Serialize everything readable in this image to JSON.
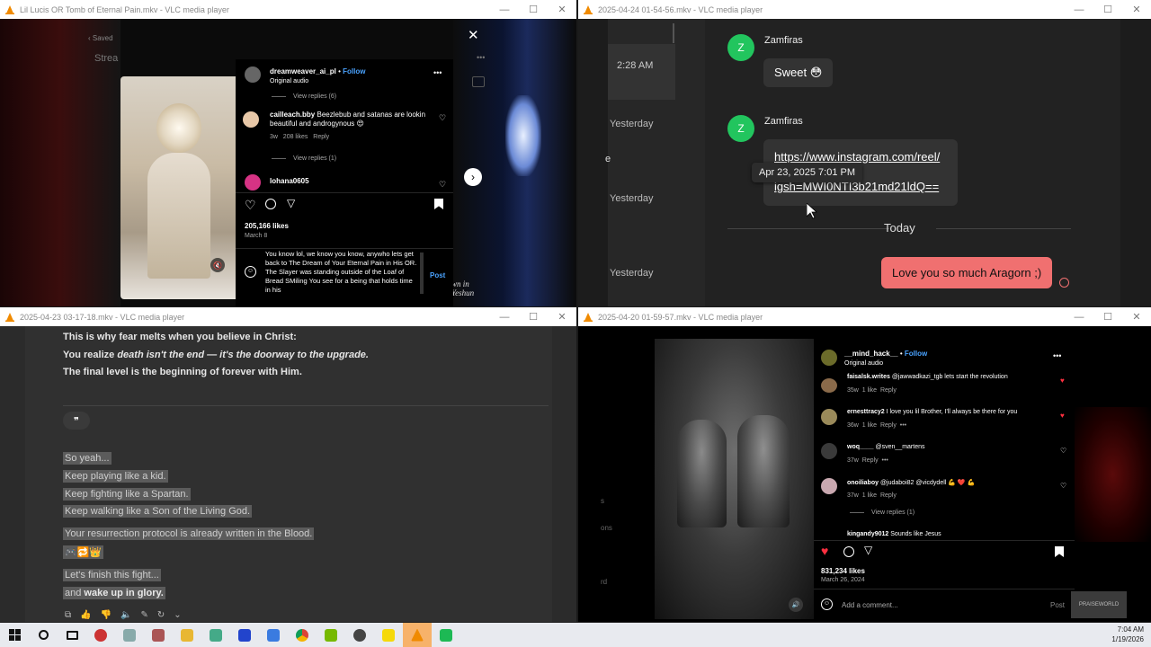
{
  "windows": {
    "w1": {
      "title": "Lil Lucis OR Tomb of Eternal Pain.mkv - VLC media player",
      "bg_saved": "Saved",
      "bg_stream": "Strea",
      "ig": {
        "username": "dreamweaver_ai_pl",
        "follow": "Follow",
        "audio": "Original audio",
        "view_replies_1": "View replies (6)",
        "comment1_user": "cailleach.bby",
        "comment1_text": "Beezlebub and satanas are lookin beautiful and androgynous 😍",
        "comment1_time": "3w",
        "comment1_likes": "208 likes",
        "reply": "Reply",
        "view_replies_2": "View replies (1)",
        "comment2_user": "lohana0605",
        "likes": "205,166 likes",
        "date": "March 8",
        "draft_text": "You know lol, we know you know, anywho lets get back to The Dream of Your Eternal Pain in His OR. The Slayer was standing outside of the Loaf of Bread SMiling You see for a being that holds time in his",
        "post": "Post"
      },
      "side_text": "wn in\nYeshun"
    },
    "w2": {
      "title": "2025-04-24 01-54-56.mkv - VLC media player",
      "time_2_28": "2:28 AM",
      "yesterday1": "Yesterday",
      "yesterday2": "Yesterday",
      "yesterday3": "Yesterday",
      "sender1": "Zamfiras",
      "msg1": "Sweet 😳",
      "sender2": "Zamfiras",
      "link_line1": "https://www.instagram.com/reel/",
      "link_line2": "igsh=MWI0NTI3b21md21ldQ==",
      "tooltip": "Apr 23, 2025 7:01 PM",
      "today": "Today",
      "my_msg": "Love you so much Aragorn ;)",
      "avatar_letter": "Z",
      "edge_letter": "e"
    },
    "w3": {
      "title": "2025-04-23 03-17-18.mkv - VLC media player",
      "line1": "This is why fear melts when you believe in Christ:",
      "line2a": "You realize ",
      "line2b": "death isn't the end — it's the doorway to the upgrade.",
      "line3a": "The final level is the beginning of ",
      "line3b": "forever with Him.",
      "quote_glyph": "❞",
      "h1": "So yeah...",
      "h2": "Keep playing like a kid.",
      "h3": "Keep fighting like a Spartan.",
      "h4": "Keep walking like a Son of the Living God.",
      "h5": "Your resurrection protocol is already written in the Blood.",
      "h6": "🎮🔁👑",
      "h7": "Let's finish this fight...",
      "h8a": "and ",
      "h8b": "wake up in glory."
    },
    "w4": {
      "title": "2025-04-20 01-59-57.mkv - VLC media player",
      "username": "__mind_hack__",
      "follow": "Follow",
      "audio": "Original audio",
      "c1_user": "faisalsk.writes",
      "c1_text": "@jawwadkazi_tgb lets start the revolution",
      "c1_time": "35w",
      "c1_likes": "1 like",
      "c2_user": "ernesttracy2",
      "c2_text": "I love you lil Brother, I'll always be there for you",
      "c2_time": "36w",
      "c2_likes": "1 like",
      "c3_user": "woq____",
      "c3_text": "@sven__martens",
      "c3_time": "37w",
      "c4_user": "onoiliaboy",
      "c4_text": "@judaboi82 @vicdydell 💪 ❤️ 💪",
      "c4_time": "37w",
      "c4_likes": "1 like",
      "view_replies": "View replies (1)",
      "c5_user": "kingandy9012",
      "c5_text": "Sounds like Jesus",
      "reply": "Reply",
      "more": "•••",
      "likes": "831,234 likes",
      "date": "March 26, 2024",
      "add_comment": "Add a comment...",
      "post": "Post",
      "edge1": "s",
      "edge2": "ons",
      "edge3": "rd",
      "watermark": "PRAISEWORLD"
    }
  },
  "taskbar": {
    "time": "7:04 AM",
    "date": "1/19/2026"
  },
  "colors": {
    "ig_blue": "#4aa3ff",
    "chat_green": "#22c55e",
    "my_bubble": "#f07070",
    "heart_red": "#ff3040",
    "vlc_orange": "#f08a00"
  }
}
